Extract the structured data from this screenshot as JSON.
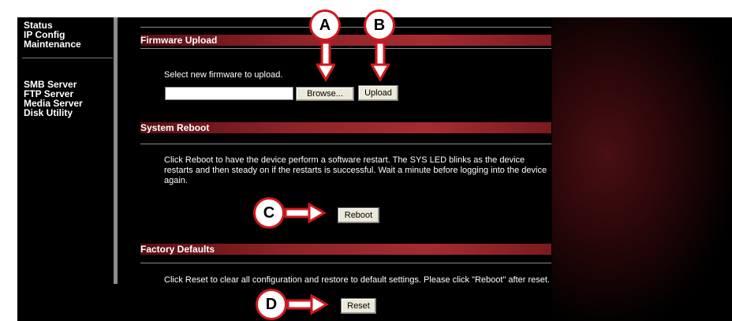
{
  "sidebar": {
    "group1": [
      "Status",
      "IP Config",
      "Maintenance"
    ],
    "group2": [
      "SMB Server",
      "FTP Server",
      "Media Server",
      "Disk Utility"
    ]
  },
  "firmware": {
    "title": "Firmware Upload",
    "instruction": "Select new firmware to upload.",
    "file_value": "",
    "browse_label": "Browse...",
    "upload_label": "Upload"
  },
  "reboot": {
    "title": "System Reboot",
    "description": "Click Reboot to have the device perform a software restart. The SYS LED blinks as the device restarts and then steady on if the restarts is successful. Wait a minute before logging into the device again.",
    "button_label": "Reboot"
  },
  "factory": {
    "title": "Factory Defaults",
    "description": "Click Reset to clear all configuration and restore to default settings. Please click \"Reboot\" after reset.",
    "button_label": "Reset"
  },
  "callouts": {
    "a": "A",
    "b": "B",
    "c": "C",
    "d": "D"
  },
  "colors": {
    "accent": "#d0181e",
    "section_bar": "#a52c31",
    "background": "#000000"
  }
}
